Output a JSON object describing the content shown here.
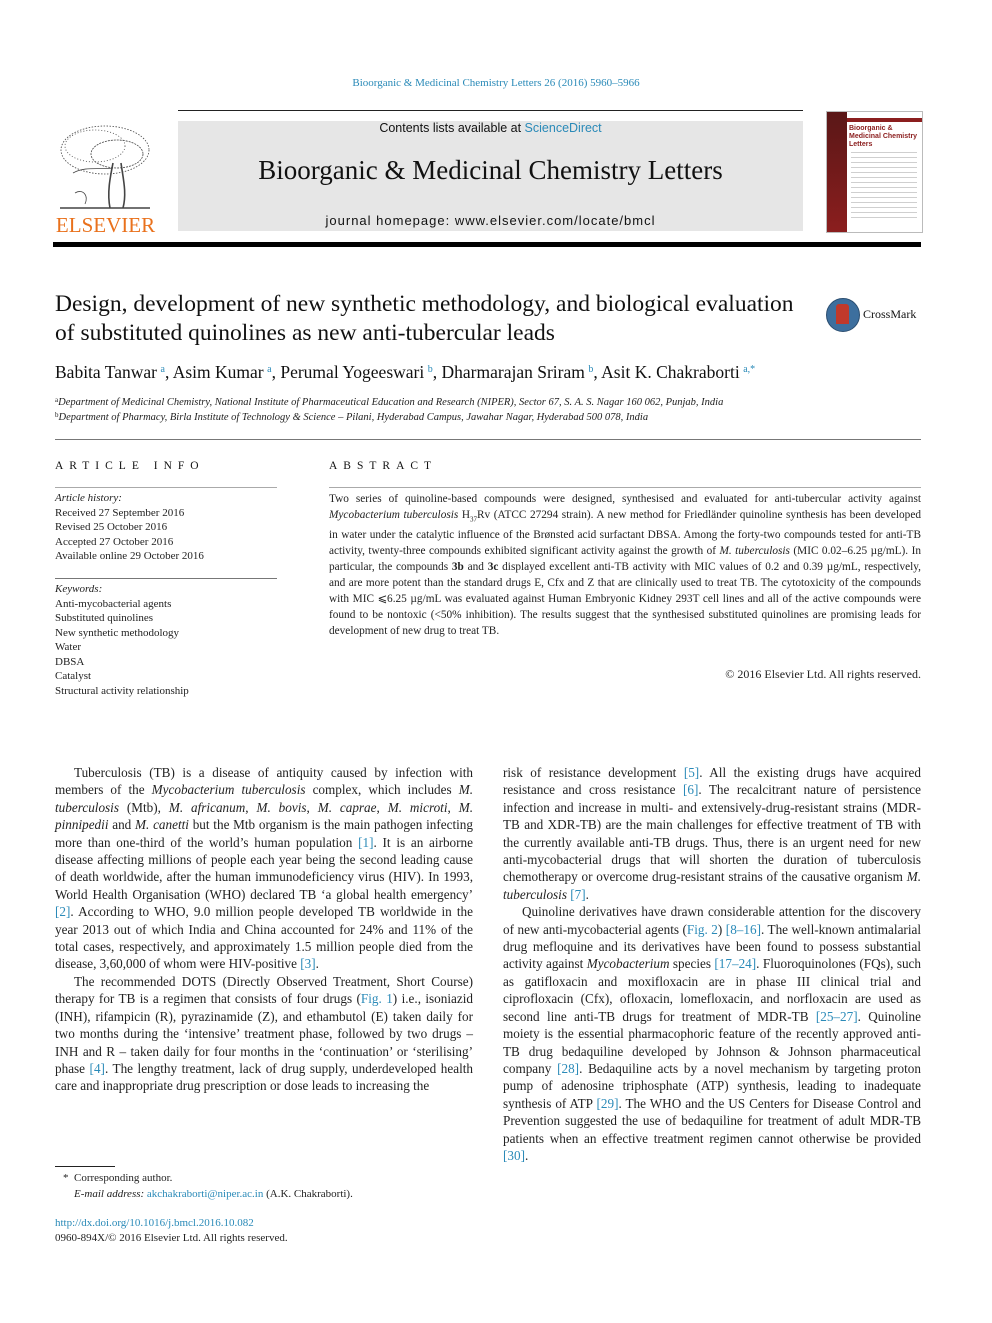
{
  "journal_reference": "Bioorganic & Medicinal Chemistry Letters 26 (2016) 5960–5966",
  "header": {
    "publisher_logo_text": "ELSEVIER",
    "contents_prefix": "Contents lists available at ",
    "contents_link": "ScienceDirect",
    "journal_title": "Bioorganic & Medicinal Chemistry Letters",
    "homepage": "journal homepage: www.elsevier.com/locate/bmcl",
    "cover_title": "Bioorganic & Medicinal Chemistry Letters"
  },
  "article": {
    "title": "Design, development of new synthetic methodology, and biological evaluation of substituted quinolines as new anti-tubercular leads",
    "crossmark_label": "CrossMark",
    "authors": [
      {
        "name": "Babita Tanwar",
        "aff": "a"
      },
      {
        "name": "Asim Kumar",
        "aff": "a"
      },
      {
        "name": "Perumal Yogeeswari",
        "aff": "b"
      },
      {
        "name": "Dharmarajan Sriram",
        "aff": "b"
      },
      {
        "name": "Asit K. Chakraborti",
        "aff": "a,*"
      }
    ],
    "affiliations": [
      {
        "mark": "a",
        "text": "Department of Medicinal Chemistry, National Institute of Pharmaceutical Education and Research (NIPER), Sector 67, S. A. S. Nagar 160 062, Punjab, India"
      },
      {
        "mark": "b",
        "text": "Department of Pharmacy, Birla Institute of Technology & Science – Pilani, Hyderabad Campus, Jawahar Nagar, Hyderabad 500 078, India"
      }
    ]
  },
  "article_info": {
    "heading": "ARTICLE INFO",
    "history_label": "Article history:",
    "history": [
      "Received 27 September 2016",
      "Revised 25 October 2016",
      "Accepted 27 October 2016",
      "Available online 29 October 2016"
    ],
    "keywords_label": "Keywords:",
    "keywords": [
      "Anti-mycobacterial agents",
      "Substituted quinolines",
      "New synthetic methodology",
      "Water",
      "DBSA",
      "Catalyst",
      "Structural activity relationship"
    ]
  },
  "abstract": {
    "heading": "ABSTRACT",
    "p1": "Two series of quinoline-based compounds were designed, synthesised and evaluated for anti-tubercular activity against ",
    "organism": "Mycobacterium tuberculosis",
    "strain_h": " H",
    "strain_sub": "37",
    "p2": "Rv (ATCC 27294 strain). A new method for Friedländer quinoline synthesis has been developed in water under the catalytic influence of the Brønsted acid surfactant DBSA. Among the forty-two compounds tested for anti-TB activity, twenty-three compounds exhibited significant activity against the growth of ",
    "organism_short": "M. tuberculosis",
    "p3": " (MIC 0.02–6.25 µg/mL). In particular, the compounds ",
    "cmpd1": "3b",
    "and": " and ",
    "cmpd2": "3c",
    "p4": " displayed excellent anti-TB activity with MIC values of 0.2 and 0.39 µg/mL, respectively, and are more potent than the standard drugs E, Cfx and Z that are clinically used to treat TB. The cytotoxicity of the compounds with MIC ⩽6.25 µg/mL was evaluated against Human Embryonic Kidney 293T cell lines and all of the active compounds were found to be nontoxic (<50% inhibition). The results suggest that the synthesised substituted quinolines are promising leads for development of new drug to treat TB.",
    "copyright": "© 2016 Elsevier Ltd. All rights reserved."
  },
  "body": {
    "left": {
      "p1": [
        {
          "t": "Tuberculosis (TB) is a disease of antiquity caused by infection with members of the "
        },
        {
          "i": "Mycobacterium tuberculosis"
        },
        {
          "t": " complex, which includes "
        },
        {
          "i": "M. tuberculosis"
        },
        {
          "t": " (Mtb), "
        },
        {
          "i": "M. africanum"
        },
        {
          "t": ", "
        },
        {
          "i": "M. bovis"
        },
        {
          "t": ", "
        },
        {
          "i": "M. caprae"
        },
        {
          "t": ", "
        },
        {
          "i": "M. microti"
        },
        {
          "t": ", "
        },
        {
          "i": "M. pinnipedii"
        },
        {
          "t": " and "
        },
        {
          "i": "M. canetti"
        },
        {
          "t": " but the Mtb organism is the main pathogen infecting more than one-third of the world’s human population "
        },
        {
          "l": "[1]"
        },
        {
          "t": ". It is an airborne disease affecting millions of people each year being the second leading cause of death worldwide, after the human immunodeficiency virus (HIV). In 1993, World Health Organisation (WHO) declared TB ‘a global health emergency’ "
        },
        {
          "l": "[2]"
        },
        {
          "t": ". According to WHO, 9.0 million people developed TB worldwide in the year 2013 out of which India and China accounted for 24% and 11% of the total cases, respectively, and approximately 1.5 million people died from the disease, 3,60,000 of whom were HIV-positive "
        },
        {
          "l": "[3]"
        },
        {
          "t": "."
        }
      ],
      "p2": [
        {
          "t": "The recommended DOTS (Directly Observed Treatment, Short Course) therapy for TB is a regimen that consists of four drugs ("
        },
        {
          "l": "Fig. 1"
        },
        {
          "t": ") i.e., isoniazid (INH), rifampicin (R), pyrazinamide (Z), and ethambutol (E) taken daily for two months during the ‘intensive’ treatment phase, followed by two drugs – INH and R – taken daily for four months in the ‘continuation’ or ‘sterilising’ phase "
        },
        {
          "l": "[4]"
        },
        {
          "t": ". The lengthy treatment, lack of drug supply, underdeveloped health care and inappropriate drug prescription or dose leads to increasing the"
        }
      ]
    },
    "right": {
      "p1": [
        {
          "t": "risk of resistance development "
        },
        {
          "l": "[5]"
        },
        {
          "t": ". All the existing drugs have acquired resistance and cross resistance "
        },
        {
          "l": "[6]"
        },
        {
          "t": ". The recalcitrant nature of persistence infection and increase in multi- and extensively-drug-resistant strains (MDR-TB and XDR-TB) are the main challenges for effective treatment of TB with the currently available anti-TB drugs. Thus, there is an urgent need for new anti-mycobacterial drugs that will shorten the duration of tuberculosis chemotherapy or overcome drug-resistant strains of the causative organism "
        },
        {
          "i": "M. tuberculosis"
        },
        {
          "t": " "
        },
        {
          "l": "[7]"
        },
        {
          "t": "."
        }
      ],
      "p2": [
        {
          "t": "Quinoline derivatives have drawn considerable attention for the discovery of new anti-mycobacterial agents ("
        },
        {
          "l": "Fig. 2"
        },
        {
          "t": ") "
        },
        {
          "l": "[8–16]"
        },
        {
          "t": ". The well-known antimalarial drug mefloquine and its derivatives have been found to possess substantial activity against "
        },
        {
          "i": "Mycobacterium"
        },
        {
          "t": " species "
        },
        {
          "l": "[17–24]"
        },
        {
          "t": ". Fluoroquinolones (FQs), such as gatifloxacin and moxifloxacin are in phase III clinical trial and ciprofloxacin (Cfx), ofloxacin, lomefloxacin, and norfloxacin are used as second line anti-TB drugs for treatment of MDR-TB "
        },
        {
          "l": "[25–27]"
        },
        {
          "t": ". Quinoline moiety is the essential pharmacophoric feature of the recently approved anti-TB drug bedaquiline developed by Johnson & Johnson pharmaceutical company "
        },
        {
          "l": "[28]"
        },
        {
          "t": ". Bedaquiline acts by a novel mechanism by targeting proton pump of adenosine triphosphate (ATP) synthesis, leading to inadequate synthesis of ATP "
        },
        {
          "l": "[29]"
        },
        {
          "t": ". The WHO and the US Centers for Disease Control and Prevention suggested the use of bedaquiline for treatment of adult MDR-TB patients when an effective treatment regimen cannot otherwise be provided "
        },
        {
          "l": "[30]"
        },
        {
          "t": "."
        }
      ]
    }
  },
  "footnote": {
    "star": "*",
    "corresponding": "Corresponding author.",
    "email_label": "E-mail address:",
    "email": "akchakraborti@niper.ac.in",
    "email_owner": " (A.K. Chakraborti)."
  },
  "doi": {
    "link": "http://dx.doi.org/10.1016/j.bmcl.2016.10.082",
    "issn_copyright": "0960-894X/© 2016 Elsevier Ltd. All rights reserved."
  },
  "colors": {
    "link": "#2a8ab8",
    "elsevier_orange": "#e9711c",
    "banner_bg": "#e6e6e6",
    "cover_red": "#8b1e1e"
  }
}
